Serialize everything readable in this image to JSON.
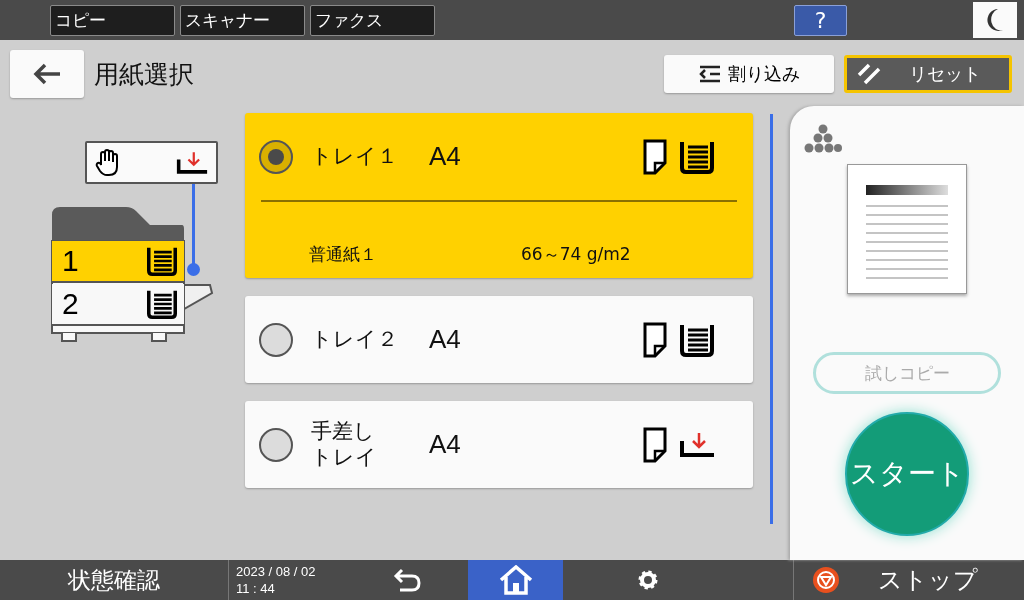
{
  "app_tabs": [
    {
      "label": "コピー"
    },
    {
      "label": "スキャナー"
    },
    {
      "label": "ファクス"
    }
  ],
  "help_button": {
    "label": "?"
  },
  "header": {
    "title": "用紙選択",
    "interrupt_button": "割り込み",
    "reset_button": "リセット"
  },
  "machine": {
    "trays": [
      {
        "label": "1",
        "selected": true
      },
      {
        "label": "2",
        "selected": false
      }
    ]
  },
  "trays": [
    {
      "kind": "tray",
      "name": "トレイ１",
      "size": "A4",
      "selected": true,
      "paper_type": "普通紙１",
      "weight": "66～74 g/m2"
    },
    {
      "kind": "tray",
      "name": "トレイ２",
      "size": "A4",
      "selected": false
    },
    {
      "kind": "bypass",
      "name": "手差しトレイ",
      "size": "A4",
      "selected": false
    }
  ],
  "preview": {
    "sample_copy_button": {
      "label": "試しコピー",
      "disabled": true
    },
    "start_button": "スタート"
  },
  "status_bar": {
    "status": "状態確認",
    "date": "2023 / 08 / 02",
    "time": "11 : 44",
    "home_selected": true,
    "stop": "ストップ"
  }
}
